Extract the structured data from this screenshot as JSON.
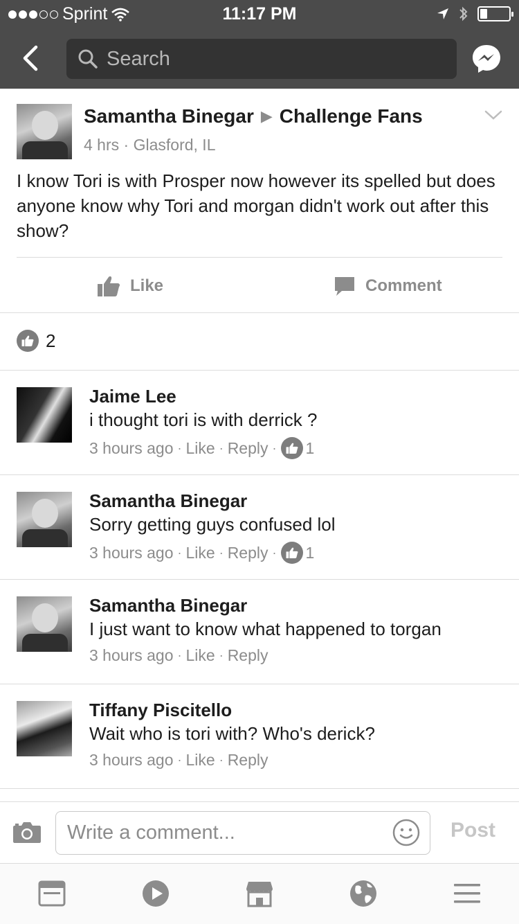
{
  "status_bar": {
    "carrier": "Sprint",
    "time": "11:17 PM",
    "signal_bars_filled": 3,
    "signal_bars_total": 5,
    "battery_level": 0.25
  },
  "nav": {
    "search_placeholder": "Search"
  },
  "post": {
    "author": "Samantha Binegar",
    "group": "Challenge Fans",
    "time": "4 hrs",
    "location": "Glasford, IL",
    "text": "I know Tori is with Prosper now however its spelled but does anyone know why Tori and morgan didn't work out after this show?",
    "like_label": "Like",
    "comment_label": "Comment",
    "reaction_count": "2"
  },
  "comments": [
    {
      "name": "Jaime Lee",
      "text": "i thought tori is with derrick ?",
      "time": "3 hours ago",
      "like_label": "Like",
      "reply_label": "Reply",
      "likes": "1"
    },
    {
      "name": "Samantha Binegar",
      "text": "Sorry getting guys confused lol",
      "time": "3 hours ago",
      "like_label": "Like",
      "reply_label": "Reply",
      "likes": "1"
    },
    {
      "name": "Samantha Binegar",
      "text": "I just want to know what happened to torgan",
      "time": "3 hours ago",
      "like_label": "Like",
      "reply_label": "Reply"
    },
    {
      "name": "Tiffany Piscitello",
      "text": "Wait who is tori with? Who's derick?",
      "time": "3 hours ago",
      "like_label": "Like",
      "reply_label": "Reply"
    }
  ],
  "composer": {
    "placeholder": "Write a comment...",
    "post_label": "Post"
  },
  "tabs": [
    "news-feed-icon",
    "video-icon",
    "marketplace-icon",
    "notifications-globe-icon",
    "menu-icon"
  ],
  "colors": {
    "header_bg": "#4b4b4b",
    "search_bg": "#333333",
    "muted_text": "#8c8c8c",
    "divider": "#dcdcdc"
  }
}
